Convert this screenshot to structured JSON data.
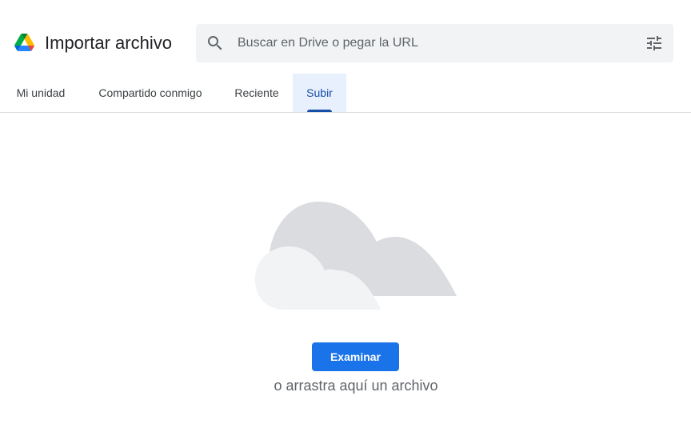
{
  "header": {
    "title": "Importar archivo",
    "logo_icon": "google-drive-logo"
  },
  "search": {
    "placeholder": "Buscar en Drive o pegar la URL",
    "value": "",
    "search_icon": "search-icon",
    "filter_icon": "tune-icon"
  },
  "tabs": [
    {
      "label": "Mi unidad",
      "active": false
    },
    {
      "label": "Compartido conmigo",
      "active": false
    },
    {
      "label": "Reciente",
      "active": false
    },
    {
      "label": "Subir",
      "active": true
    }
  ],
  "upload": {
    "button_label": "Examinar",
    "hint": "o arrastra aquí un archivo",
    "illustration": "cloud-illustration"
  },
  "colors": {
    "accent": "#1a73e8",
    "active_tab_bg": "#e8f0fe",
    "active_tab_text": "#174ea6",
    "search_bg": "#f1f3f4",
    "cloud_back": "#dadce0",
    "cloud_front": "#f1f3f4"
  }
}
